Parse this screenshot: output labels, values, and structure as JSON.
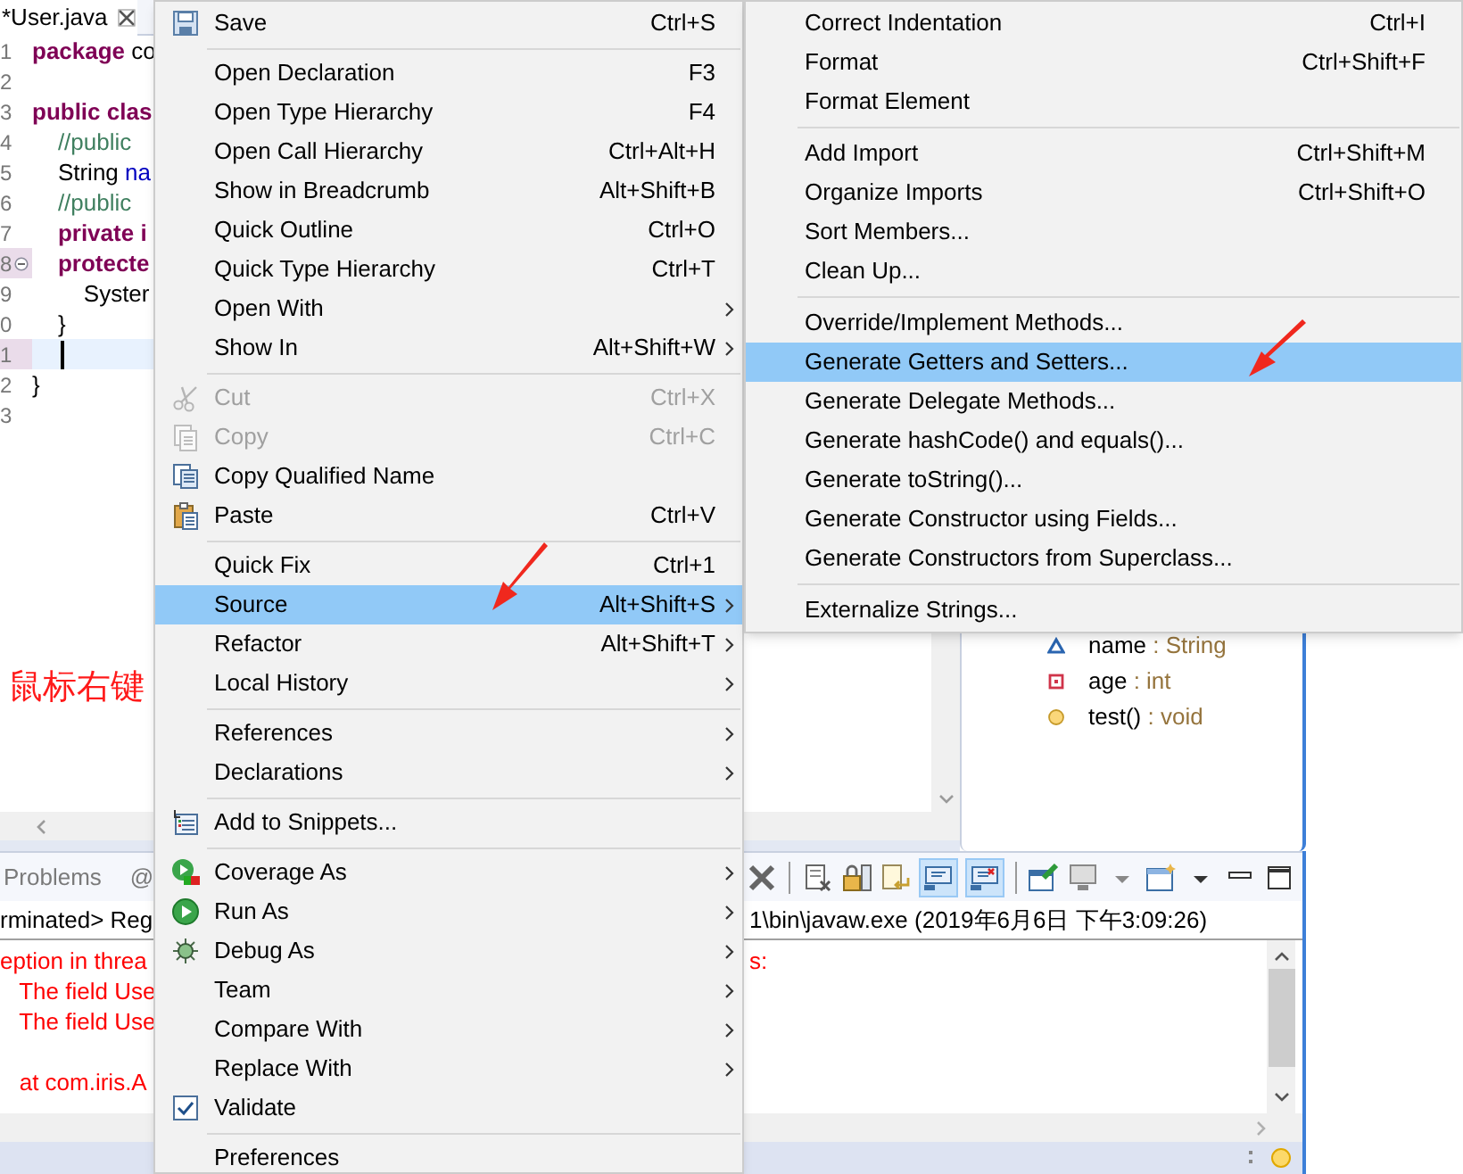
{
  "editor": {
    "tab": {
      "title": "*User.java",
      "selected": true
    },
    "lines": [
      {
        "number": "1",
        "current": false,
        "marked": false,
        "folding": false,
        "tokens": [
          {
            "text": "package",
            "kind": "keyword"
          },
          {
            "text": " co",
            "kind": "plain"
          }
        ]
      },
      {
        "number": "2",
        "current": false,
        "marked": false,
        "folding": false
      },
      {
        "number": "3",
        "current": false,
        "marked": false,
        "folding": false,
        "tokens": [
          {
            "text": "public clas",
            "kind": "keyword"
          }
        ]
      },
      {
        "number": "4",
        "current": false,
        "marked": false,
        "folding": false,
        "tokens": [
          {
            "text": "    //public",
            "kind": "comment"
          }
        ]
      },
      {
        "number": "5",
        "current": false,
        "marked": false,
        "folding": false,
        "tokens": [
          {
            "text": "    String ",
            "kind": "plain"
          },
          {
            "text": "na",
            "kind": "field"
          }
        ]
      },
      {
        "number": "6",
        "current": false,
        "marked": false,
        "folding": false,
        "tokens": [
          {
            "text": "    //public",
            "kind": "comment"
          }
        ]
      },
      {
        "number": "7",
        "current": false,
        "marked": false,
        "folding": false,
        "tokens": [
          {
            "text": "    private i",
            "kind": "keyword"
          }
        ]
      },
      {
        "number": "8",
        "current": false,
        "marked": true,
        "folding": true,
        "tokens": [
          {
            "text": "    protecte",
            "kind": "keyword"
          }
        ]
      },
      {
        "number": "9",
        "current": false,
        "marked": false,
        "folding": false,
        "tokens": [
          {
            "text": "        Syster",
            "kind": "plain"
          }
        ]
      },
      {
        "number": "0",
        "current": false,
        "marked": false,
        "folding": false,
        "tokens": [
          {
            "text": "    }",
            "kind": "plain"
          }
        ]
      },
      {
        "number": "1",
        "current": true,
        "marked": true,
        "folding": false
      },
      {
        "number": "2",
        "current": false,
        "marked": false,
        "folding": false,
        "tokens": [
          {
            "text": "}",
            "kind": "plain"
          }
        ]
      },
      {
        "number": "3",
        "current": false,
        "marked": false,
        "folding": false
      }
    ]
  },
  "annotation": {
    "text": "鼠标右键"
  },
  "outline": {
    "items": [
      {
        "name": "name",
        "type": " : String",
        "kind": "package_field"
      },
      {
        "name": "age",
        "type": " : int",
        "kind": "private_field"
      },
      {
        "name": "test()",
        "type": " : void",
        "kind": "protected_method"
      }
    ]
  },
  "bottom_panel": {
    "tabs": [
      {
        "label": "Problems",
        "selected": false
      },
      {
        "label": "@",
        "selected": false
      }
    ],
    "toolbar_toggles": [
      {
        "selected": true
      },
      {
        "selected": true
      }
    ],
    "console": {
      "header_left": "rminated> Reg",
      "header_right": "1\\bin\\javaw.exe (2019年6月6日 下午3:09:26)",
      "lines": [
        {
          "left": "eption in threa",
          "right": "s:",
          "kind": "error"
        },
        {
          "left": "   The field Use",
          "kind": "error"
        },
        {
          "left": "   The field Use",
          "kind": "error"
        },
        {
          "kind": "error"
        },
        {
          "left": "   at com.iris.A",
          "kind": "error"
        }
      ]
    }
  },
  "context_menu": {
    "sections": [
      [
        {
          "label": "Save",
          "shortcut": "Ctrl+S",
          "submenu": false,
          "disabled": false,
          "selected": false
        }
      ],
      [
        {
          "label": "Open Declaration",
          "shortcut": "F3",
          "submenu": false,
          "disabled": false,
          "selected": false
        },
        {
          "label": "Open Type Hierarchy",
          "shortcut": "F4",
          "submenu": false,
          "disabled": false,
          "selected": false
        },
        {
          "label": "Open Call Hierarchy",
          "shortcut": "Ctrl+Alt+H",
          "submenu": false,
          "disabled": false,
          "selected": false
        },
        {
          "label": "Show in Breadcrumb",
          "shortcut": "Alt+Shift+B",
          "submenu": false,
          "disabled": false,
          "selected": false
        },
        {
          "label": "Quick Outline",
          "shortcut": "Ctrl+O",
          "submenu": false,
          "disabled": false,
          "selected": false
        },
        {
          "label": "Quick Type Hierarchy",
          "shortcut": "Ctrl+T",
          "submenu": false,
          "disabled": false,
          "selected": false
        },
        {
          "label": "Open With",
          "submenu": true,
          "disabled": false,
          "selected": false
        },
        {
          "label": "Show In",
          "shortcut": "Alt+Shift+W",
          "submenu": true,
          "disabled": false,
          "selected": false
        }
      ],
      [
        {
          "label": "Cut",
          "shortcut": "Ctrl+X",
          "submenu": false,
          "disabled": true,
          "selected": false
        },
        {
          "label": "Copy",
          "shortcut": "Ctrl+C",
          "submenu": false,
          "disabled": true,
          "selected": false
        },
        {
          "label": "Copy Qualified Name",
          "submenu": false,
          "disabled": false,
          "selected": false
        },
        {
          "label": "Paste",
          "shortcut": "Ctrl+V",
          "submenu": false,
          "disabled": false,
          "selected": false
        }
      ],
      [
        {
          "label": "Quick Fix",
          "shortcut": "Ctrl+1",
          "submenu": false,
          "disabled": false,
          "selected": false
        },
        {
          "label": "Source",
          "shortcut": "Alt+Shift+S",
          "submenu": true,
          "disabled": false,
          "selected": true
        },
        {
          "label": "Refactor",
          "shortcut": "Alt+Shift+T",
          "submenu": true,
          "disabled": false,
          "selected": false
        },
        {
          "label": "Local History",
          "submenu": true,
          "disabled": false,
          "selected": false
        }
      ],
      [
        {
          "label": "References",
          "submenu": true,
          "disabled": false,
          "selected": false
        },
        {
          "label": "Declarations",
          "submenu": true,
          "disabled": false,
          "selected": false
        }
      ],
      [
        {
          "label": "Add to Snippets...",
          "submenu": false,
          "disabled": false,
          "selected": false
        }
      ],
      [
        {
          "label": "Coverage As",
          "submenu": true,
          "disabled": false,
          "selected": false
        },
        {
          "label": "Run As",
          "submenu": true,
          "disabled": false,
          "selected": false
        },
        {
          "label": "Debug As",
          "submenu": true,
          "disabled": false,
          "selected": false
        },
        {
          "label": "Team",
          "submenu": true,
          "disabled": false,
          "selected": false
        },
        {
          "label": "Compare With",
          "submenu": true,
          "disabled": false,
          "selected": false
        },
        {
          "label": "Replace With",
          "submenu": true,
          "disabled": false,
          "selected": false
        },
        {
          "label": "Validate",
          "submenu": false,
          "disabled": false,
          "selected": false
        }
      ],
      [
        {
          "label": "Preferences",
          "submenu": false,
          "disabled": false,
          "selected": false
        }
      ]
    ]
  },
  "source_submenu": {
    "sections": [
      [
        {
          "label": "Correct Indentation",
          "shortcut": "Ctrl+I",
          "selected": false
        },
        {
          "label": "Format",
          "shortcut": "Ctrl+Shift+F",
          "selected": false
        },
        {
          "label": "Format Element",
          "selected": false
        }
      ],
      [
        {
          "label": "Add Import",
          "shortcut": "Ctrl+Shift+M",
          "selected": false
        },
        {
          "label": "Organize Imports",
          "shortcut": "Ctrl+Shift+O",
          "selected": false
        },
        {
          "label": "Sort Members...",
          "selected": false
        },
        {
          "label": "Clean Up...",
          "selected": false
        }
      ],
      [
        {
          "label": "Override/Implement Methods...",
          "selected": false
        },
        {
          "label": "Generate Getters and Setters...",
          "selected": true
        },
        {
          "label": "Generate Delegate Methods...",
          "selected": false
        },
        {
          "label": "Generate hashCode() and equals()...",
          "selected": false
        },
        {
          "label": "Generate toString()...",
          "selected": false
        },
        {
          "label": "Generate Constructor using Fields...",
          "selected": false
        },
        {
          "label": "Generate Constructors from Superclass...",
          "selected": false
        }
      ],
      [
        {
          "label": "Externalize Strings...",
          "selected": false
        }
      ]
    ]
  }
}
